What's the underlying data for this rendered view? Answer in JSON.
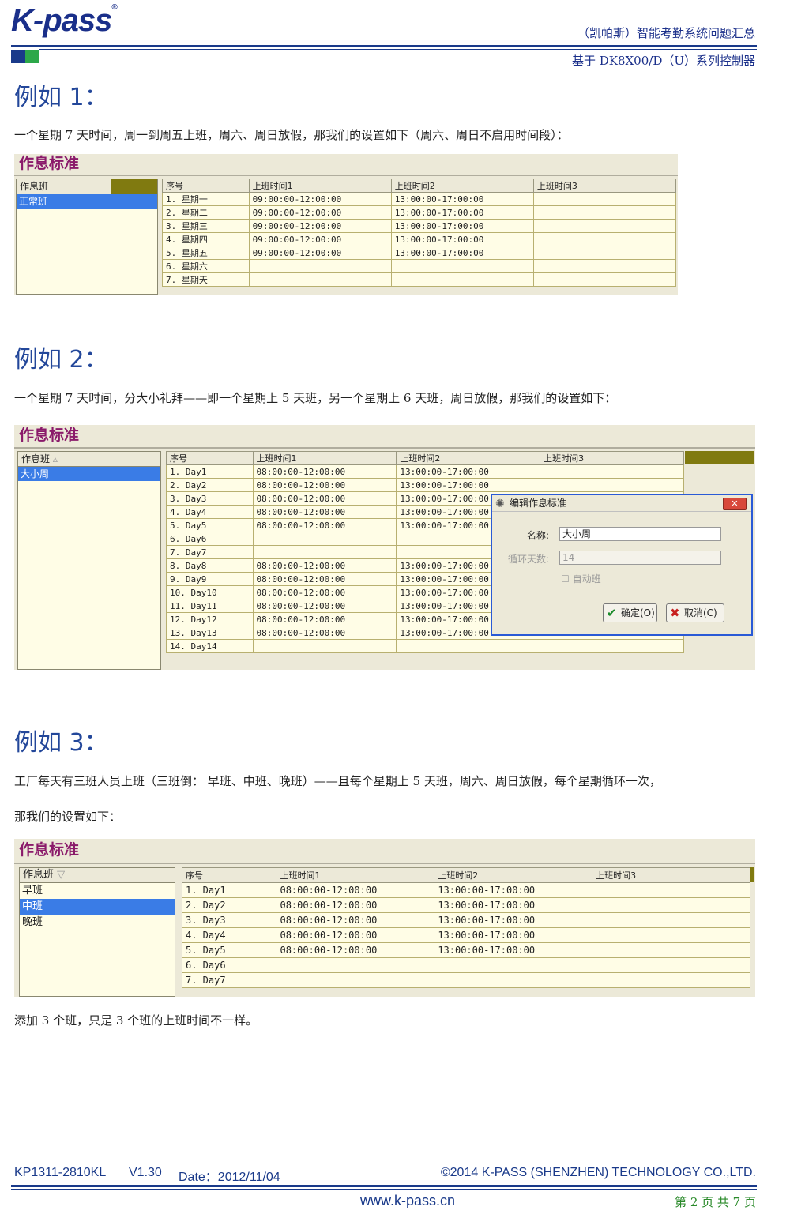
{
  "header": {
    "logo": "K-pass",
    "logo_reg": "®",
    "line1": "（凯帕斯）智能考勤系统问题汇总",
    "line2": "基于 DK8X00/D（U）系列控制器"
  },
  "example1": {
    "title": "例如 1：",
    "text": "一个星期 7 天时间，周一到周五上班，周六、周日放假，那我们的设置如下（周六、周日不启用时间段）：",
    "panel_title": "作息标准",
    "list_header": "作息班",
    "list_items": [
      "正常班"
    ],
    "grid_headers": [
      "序号",
      "上班时间1",
      "上班时间2",
      "上班时间3"
    ],
    "rows": [
      [
        "1. 星期一",
        "09:00:00-12:00:00",
        "13:00:00-17:00:00",
        ""
      ],
      [
        "2. 星期二",
        "09:00:00-12:00:00",
        "13:00:00-17:00:00",
        ""
      ],
      [
        "3. 星期三",
        "09:00:00-12:00:00",
        "13:00:00-17:00:00",
        ""
      ],
      [
        "4. 星期四",
        "09:00:00-12:00:00",
        "13:00:00-17:00:00",
        ""
      ],
      [
        "5. 星期五",
        "09:00:00-12:00:00",
        "13:00:00-17:00:00",
        ""
      ],
      [
        "6. 星期六",
        "",
        "",
        ""
      ],
      [
        "7. 星期天",
        "",
        "",
        ""
      ]
    ]
  },
  "example2": {
    "title": "例如 2：",
    "text": "一个星期 7 天时间，分大小礼拜——即一个星期上 5 天班，另一个星期上 6 天班，周日放假，那我们的设置如下：",
    "panel_title": "作息标准",
    "list_header": "作息班",
    "list_items": [
      "大小周"
    ],
    "grid_headers": [
      "序号",
      "上班时间1",
      "上班时间2",
      "上班时间3"
    ],
    "rows": [
      [
        "1. Day1",
        "08:00:00-12:00:00",
        "13:00:00-17:00:00",
        ""
      ],
      [
        "2. Day2",
        "08:00:00-12:00:00",
        "13:00:00-17:00:00",
        ""
      ],
      [
        "3. Day3",
        "08:00:00-12:00:00",
        "13:00:00-17:00:00",
        ""
      ],
      [
        "4. Day4",
        "08:00:00-12:00:00",
        "13:00:00-17:00:00",
        ""
      ],
      [
        "5. Day5",
        "08:00:00-12:00:00",
        "13:00:00-17:00:00",
        ""
      ],
      [
        "6. Day6",
        "",
        "",
        ""
      ],
      [
        "7. Day7",
        "",
        "",
        ""
      ],
      [
        "8. Day8",
        "08:00:00-12:00:00",
        "13:00:00-17:00:00",
        ""
      ],
      [
        "9. Day9",
        "08:00:00-12:00:00",
        "13:00:00-17:00:00",
        ""
      ],
      [
        "10. Day10",
        "08:00:00-12:00:00",
        "13:00:00-17:00:00",
        ""
      ],
      [
        "11. Day11",
        "08:00:00-12:00:00",
        "13:00:00-17:00:00",
        ""
      ],
      [
        "12. Day12",
        "08:00:00-12:00:00",
        "13:00:00-17:00:00",
        ""
      ],
      [
        "13. Day13",
        "08:00:00-12:00:00",
        "13:00:00-17:00:00",
        ""
      ],
      [
        "14. Day14",
        "",
        "",
        ""
      ]
    ],
    "dialog": {
      "title": "编辑作息标准",
      "name_label": "名称:",
      "name_value": "大小周",
      "days_label": "循环天数:",
      "days_value": "14",
      "auto_label": "自动班",
      "ok_label": "确定(O)",
      "cancel_label": "取消(C)"
    }
  },
  "example3": {
    "title": "例如 3：",
    "text1": "工厂每天有三班人员上班（三班倒： 早班、中班、晚班）——且每个星期上 5 天班，周六、周日放假，每个星期循环一次，",
    "text2": "那我们的设置如下：",
    "panel_title": "作息标准",
    "list_header": "作息班",
    "list_items": [
      "早班",
      "中班",
      "晚班"
    ],
    "grid_headers": [
      "序号",
      "上班时间1",
      "上班时间2",
      "上班时间3"
    ],
    "rows": [
      [
        "1. Day1",
        "08:00:00-12:00:00",
        "13:00:00-17:00:00",
        ""
      ],
      [
        "2. Day2",
        "08:00:00-12:00:00",
        "13:00:00-17:00:00",
        ""
      ],
      [
        "3. Day3",
        "08:00:00-12:00:00",
        "13:00:00-17:00:00",
        ""
      ],
      [
        "4. Day4",
        "08:00:00-12:00:00",
        "13:00:00-17:00:00",
        ""
      ],
      [
        "5. Day5",
        "08:00:00-12:00:00",
        "13:00:00-17:00:00",
        ""
      ],
      [
        "6. Day6",
        "",
        "",
        ""
      ],
      [
        "7. Day7",
        "",
        "",
        ""
      ]
    ],
    "note": "添加 3 个班，只是 3 个班的上班时间不一样。"
  },
  "footer": {
    "doc_id": "KP1311-2810KL",
    "version": "V1.30",
    "date": "Date：2012/11/04",
    "copyright": "©2014 K-PASS (SHENZHEN) TECHNOLOGY CO.,LTD.",
    "website": "www.k-pass.cn",
    "page": "第 2 页 共 7 页"
  }
}
